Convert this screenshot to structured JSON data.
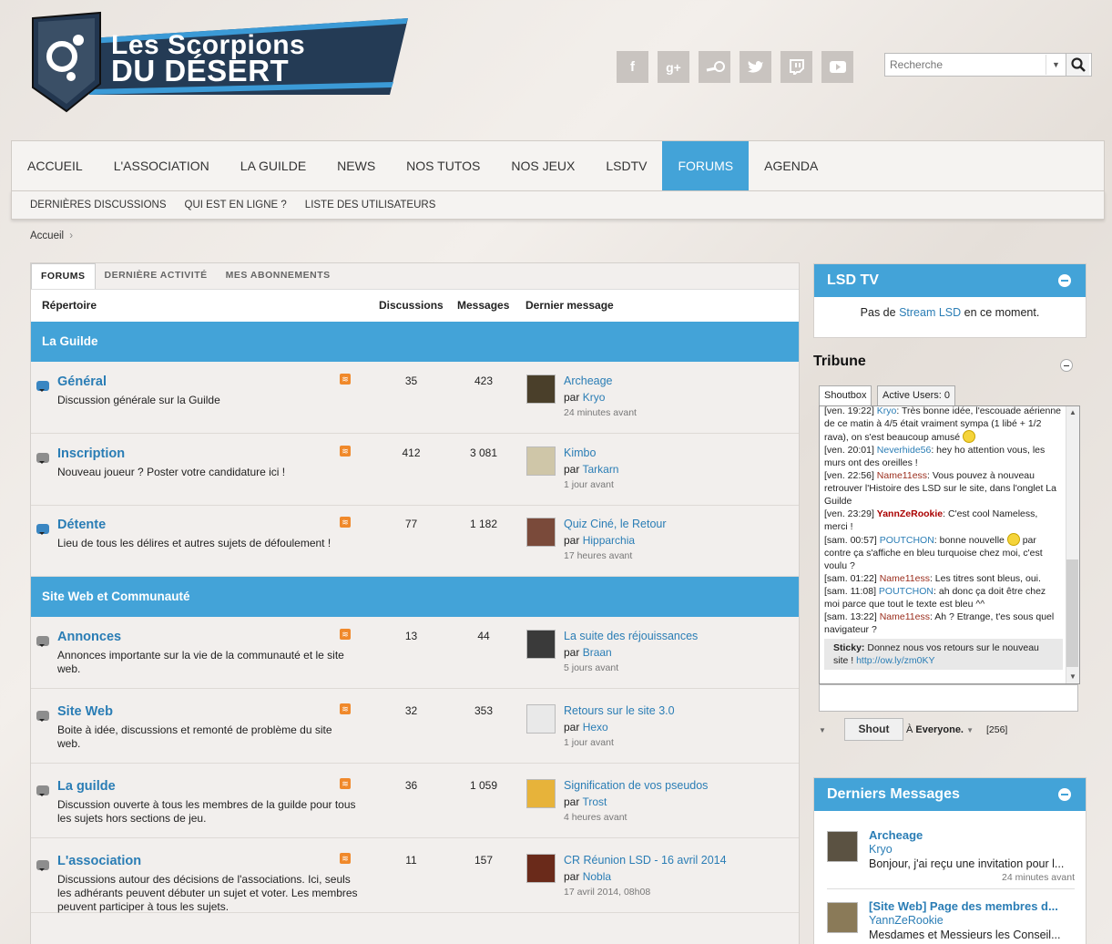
{
  "site": {
    "logo_line1": "Les Scorpions",
    "logo_line2": "Du Désert"
  },
  "social": [
    "facebook-icon",
    "google-plus-icon",
    "steam-icon",
    "twitter-icon",
    "twitch-icon",
    "youtube-icon"
  ],
  "search": {
    "placeholder": "Recherche"
  },
  "nav": [
    "Accueil",
    "L'Association",
    "La Guilde",
    "News",
    "Nos Tutos",
    "Nos Jeux",
    "LSDTV",
    "Forums",
    "Agenda"
  ],
  "nav_active": "Forums",
  "subnav": [
    "Dernières discussions",
    "Qui est en ligne ?",
    "Liste des utilisateurs"
  ],
  "breadcrumb": "Accueil",
  "tabs": [
    "Forums",
    "Dernière activité",
    "Mes abonnements"
  ],
  "columns": {
    "dir": "Répertoire",
    "disc": "Discussions",
    "msg": "Messages",
    "last": "Dernier message"
  },
  "categories": [
    "La Guilde",
    "Site Web et Communauté"
  ],
  "forums": [
    {
      "title": "Général",
      "desc": "Discussion générale sur la Guilde",
      "disc": "35",
      "msgs": "423",
      "last_title": "Archeage",
      "by": "Kryo",
      "when": "24 minutes avant",
      "unread": true
    },
    {
      "title": "Inscription",
      "desc": "Nouveau joueur ? Poster votre candidature ici !",
      "disc": "412",
      "msgs": "3 081",
      "last_title": "Kimbo",
      "by": "Tarkarn",
      "when": "1 jour avant",
      "unread": false
    },
    {
      "title": "Détente",
      "desc": "Lieu de tous les délires et autres sujets de défoulement !",
      "disc": "77",
      "msgs": "1 182",
      "last_title": "Quiz Ciné, le Retour",
      "by": "Hipparchia",
      "when": "17 heures avant",
      "unread": true
    },
    {
      "title": "Annonces",
      "desc": "Annonces importante sur la vie de la communauté et le site web.",
      "disc": "13",
      "msgs": "44",
      "last_title": "La suite des réjouissances",
      "by": "Braan",
      "when": "5 jours avant",
      "unread": false
    },
    {
      "title": "Site Web",
      "desc": "Boite à idée, discussions et remonté de problème du site web.",
      "disc": "32",
      "msgs": "353",
      "last_title": "Retours sur le site 3.0",
      "by": "Hexo",
      "when": "1 jour avant",
      "unread": false
    },
    {
      "title": "La guilde",
      "desc": "Discussion ouverte à tous les membres de la guilde pour tous les sujets hors sections de jeu.",
      "disc": "36",
      "msgs": "1 059",
      "last_title": "Signification de vos pseudos",
      "by": "Trost",
      "when": "4 heures avant",
      "unread": false
    },
    {
      "title": "L'association",
      "desc": "Discussions autour des décisions de l'associations. Ici, seuls les adhérants peuvent débuter un sujet et voter. Les membres peuvent participer à tous les sujets.",
      "disc": "11",
      "msgs": "157",
      "last_title": "CR Réunion LSD - 16 avril 2014",
      "by": "Nobla",
      "when": "17 avril 2014, 08h08",
      "unread": false
    }
  ],
  "par": "par",
  "lsdtv": {
    "title": "LSD TV",
    "pre": "Pas de ",
    "link": "Stream LSD",
    "post": " en ce moment."
  },
  "tribune": {
    "title": "Tribune",
    "tab1": "Shoutbox",
    "tab2": "Active Users: 0",
    "messages": [
      {
        "t": "[ven. 19:22] ",
        "u": "Kryo",
        "c": "u1",
        "m": ": Très bonne idée, l'escouade aérienne de ce matin à 4/5 était vraiment sympa (1 libé + 1/2 rava), on s'est beaucoup amusé",
        "smile": true
      },
      {
        "t": "[ven. 20:01] ",
        "u": "Neverhide56",
        "c": "u1",
        "m": ": hey ho attention vous, les murs ont des oreilles !",
        "smile": false
      },
      {
        "t": "[ven. 22:56] ",
        "u": "Name11ess",
        "c": "u2",
        "m": ": Vous pouvez à nouveau retrouver l'Histoire des LSD sur le site, dans l'onglet La Guilde",
        "smile": false
      },
      {
        "t": "[ven. 23:29] ",
        "u": "YannZeRookie",
        "c": "u3",
        "m": ": C'est cool Nameless, merci !",
        "smile": false
      },
      {
        "t": "[sam. 00:57] ",
        "u": "POUTCHON",
        "c": "u1",
        "m": ": bonne nouvelle",
        "smile": true,
        "m2": " par contre ça s'affiche en bleu turquoise chez moi, c'est voulu ?"
      },
      {
        "t": "[sam. 01:22] ",
        "u": "Name11ess",
        "c": "u2",
        "m": ": Les titres sont bleus, oui.",
        "smile": false
      },
      {
        "t": "[sam. 11:08] ",
        "u": "POUTCHON",
        "c": "u1",
        "m": ": ah donc ça doit être chez moi parce que tout le texte est bleu ^^",
        "smile": false
      },
      {
        "t": "[sam. 13:22] ",
        "u": "Name11ess",
        "c": "u2",
        "m": ": Ah ? Etrange, t'es sous quel navigateur ?",
        "smile": false
      }
    ],
    "sticky_label": "Sticky:",
    "sticky_text": " Donnez nous vos retours sur le nouveau site ! ",
    "sticky_link": "http://ow.ly/zm0KY",
    "shout_btn": "Shout",
    "to": "À ",
    "everyone": "Everyone.",
    "count": "[256]"
  },
  "derniers": {
    "title": "Derniers Messages",
    "items": [
      {
        "title": "Archeage",
        "user": "Kryo",
        "excerpt": "Bonjour, j'ai reçu une invitation pour l...",
        "when": "24 minutes avant"
      },
      {
        "title": "[Site Web] Page des membres d...",
        "user": "YannZeRookie",
        "excerpt": "Mesdames et Messieurs les Conseil...",
        "when": ""
      }
    ]
  }
}
